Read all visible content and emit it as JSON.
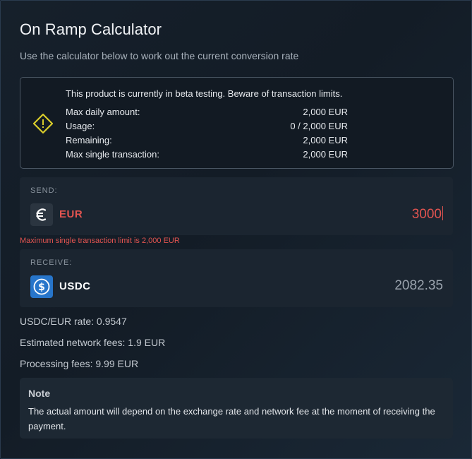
{
  "header": {
    "title": "On Ramp Calculator",
    "subtitle": "Use the calculator below to work out the current conversion rate"
  },
  "beta_notice": {
    "icon": "warning-diamond-icon",
    "message": "This product is currently in beta testing. Beware of transaction limits.",
    "limits": [
      {
        "label": "Max daily amount:",
        "value": "2,000 EUR"
      },
      {
        "label": "Usage:",
        "value": "0 / 2,000 EUR"
      },
      {
        "label": "Remaining:",
        "value": "2,000 EUR"
      },
      {
        "label": "Max single transaction:",
        "value": "2,000 EUR"
      }
    ]
  },
  "send": {
    "label": "SEND:",
    "currency_icon": "euro-icon",
    "currency": "EUR",
    "amount": "3000",
    "error": "Maximum single transaction limit is 2,000 EUR"
  },
  "receive": {
    "label": "RECEIVE:",
    "currency_icon": "usdc-dollar-icon",
    "currency": "USDC",
    "amount": "2082.35"
  },
  "rates": {
    "rate": "USDC/EUR rate: 0.9547",
    "network_fees": "Estimated network fees: 1.9 EUR",
    "processing_fees": "Processing fees: 9.99 EUR"
  },
  "note": {
    "title": "Note",
    "body": "The actual amount will depend on the exchange rate and network fee at the moment of receiving the payment."
  },
  "colors": {
    "error": "#e25450",
    "warning": "#d8cc2b",
    "usdc": "#2775ca"
  }
}
